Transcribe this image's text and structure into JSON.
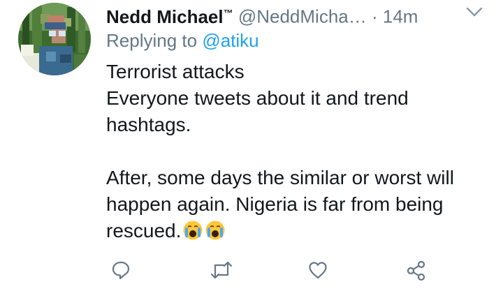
{
  "tweet": {
    "author_name": "Nedd Michael",
    "author_name_suffix": "™",
    "author_handle": "@NeddMicha…",
    "separator": "·",
    "timestamp": "14m",
    "replying_prefix": "Replying to",
    "replying_mention": "@atiku",
    "body_lines": [
      "Terrorist attacks",
      "Everyone tweets about it and trend hashtags.",
      "After, some days the similar or worst will happen again. Nigeria is far from being rescued."
    ]
  },
  "icons": {
    "menu": "chevron-down-icon",
    "emoji": "crying-face-emoji",
    "reply": "reply-icon",
    "retweet": "retweet-icon",
    "like": "heart-icon",
    "share": "share-icon"
  },
  "colors": {
    "text": "#14171a",
    "secondary": "#657786",
    "link": "#1da1f2",
    "icon": "#657786"
  }
}
